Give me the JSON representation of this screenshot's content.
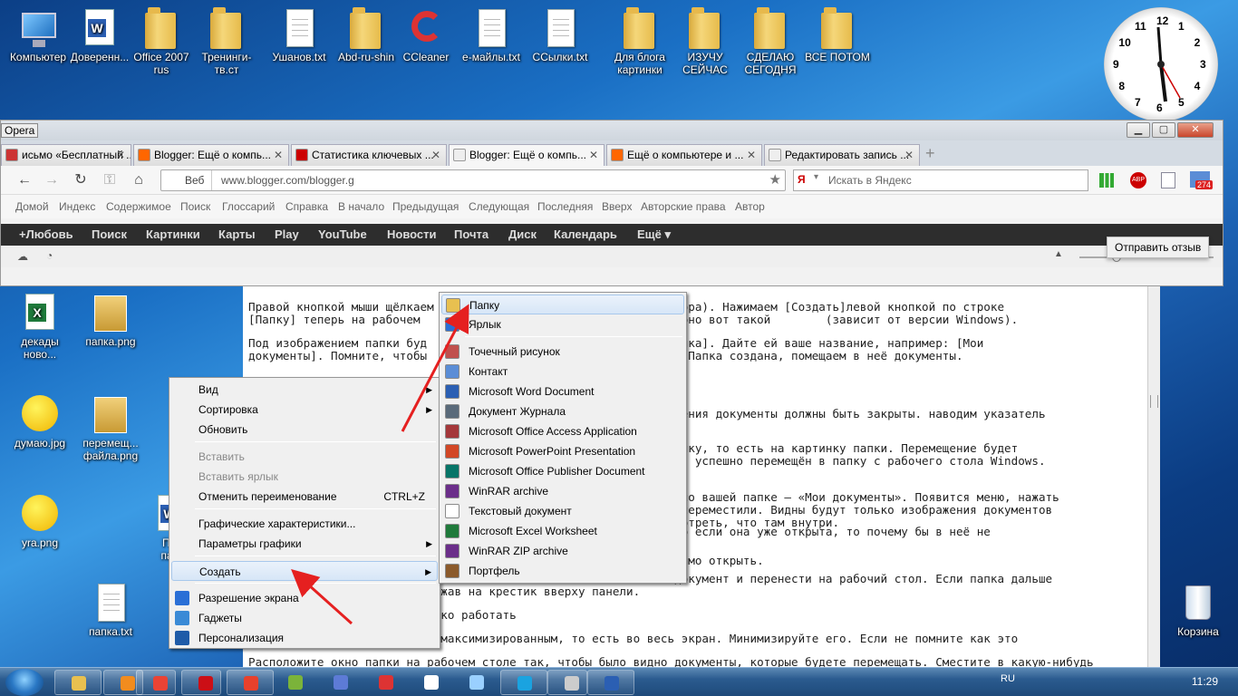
{
  "desktop": {
    "top_icons": [
      "Компьютер",
      "Доверенн...",
      "Office 2007\nrus",
      "Тренинги-\nтв.ст",
      "Ушанов.txt",
      "Abd-ru-shin",
      "CCleaner",
      "е-майлы.txt",
      "ССылки.txt",
      "Для блога\nкартинки",
      "ИЗУЧУ\nСЕЙЧАС",
      "СДЕЛАЮ\nСЕГОДНЯ",
      "ВСЕ ПОТОМ"
    ],
    "left_icons": [
      "декады\nново...",
      "папка.png",
      "думаю.jpg",
      "перемещ...\nфайла.png",
      "yra.png",
      "Пон\nпапк",
      "папка.txt"
    ],
    "recycle": "Корзина"
  },
  "clock_gadget": {
    "numbers": [
      "12",
      "1",
      "2",
      "3",
      "4",
      "5",
      "6",
      "7",
      "8",
      "9",
      "10",
      "11"
    ]
  },
  "browser": {
    "app": "Opera",
    "win_min": "▁",
    "win_max": "▢",
    "win_close": "✕",
    "tabs": [
      {
        "label": "исьмо «Бесплатный ...",
        "color": "#c33"
      },
      {
        "label": "Blogger: Ещё о компь...",
        "color": "#f60"
      },
      {
        "label": "Статистика ключевых ...",
        "color": "#c00"
      },
      {
        "label": "Blogger: Ещё о компь...",
        "color": "#eee"
      },
      {
        "label": "Ещё о компьютере и ...",
        "color": "#f60"
      },
      {
        "label": "Редактировать запись ...",
        "color": "#eee"
      }
    ],
    "tab_close": "✕",
    "veb": "Веб",
    "url": "www.blogger.com/blogger.g",
    "search_placeholder": "Искать в Яндекс",
    "badge": "274",
    "bookmarks": [
      "Домой",
      "Индекс",
      "Содержимое",
      "Поиск",
      "Глоссарий",
      "Справка",
      "В начало",
      "Предыдущая",
      "Следующая",
      "Последняя",
      "Вверх",
      "Авторские права",
      "Автор"
    ],
    "gbar": [
      "+Любовь",
      "Поиск",
      "Картинки",
      "Карты",
      "Play",
      "YouTube",
      "Новости",
      "Почта",
      "Диск",
      "Календарь",
      "Ещё ▾"
    ],
    "feedback": "Отправить отзыв"
  },
  "page_text": [
    "Правой кнопкой мыши щёлкаем                             е монитора). Нажимаем \u0001[Создать]\u0001левой кнопкой по строке",
    "[Папку] \u0001теперь на рабочем                             ок, примерно вот такой        (зависит от версии Windows).",
    "Под изображением папки буд                             новая папка]. Дайте ей ваше название, например: [Мои",
    "документы]. Помните, чтобы                             [Enter]. Папка создана, помещаем в неё документы.",
    "                                                        перемещения документы должны быть закрыты. наводим указатель",
    "                                                        т на папку, то есть на картинку папки. Перемещение будет",
    "                                                        документ успешно перемещён в папку с рабочего стола Windows.",
    "                                                        правой по вашей папке – «Мои документы». Появится меню, нажать",
    "                                                        е туда переместили. Видны будут только изображения документов",
    "                                                         и посмотреть, что там внутри.",
    "                                                        вать, но если она уже открыта, то почему бы в неё не",
    "                                                        необходимо открыть.",
    "                                                        й вам документ и перенести на рабочий стол. Если папка дальше",
    "                 акройте, нажав на крестик вверху панели.",
    "                   можно легко работать",
    "                  открыться максимизированным, то есть во весь экран. Минимизируйте его. Если не помните как это",
    "Расположите окно папки на рабочем столе так, чтобы было видно документы, которые будете перемещать. Сместите в какую-нибудь"
  ],
  "context_menu": {
    "items": [
      "Вид",
      "Сортировка",
      "Обновить",
      "Вставить",
      "Вставить ярлык",
      "Отменить переименование",
      "Графические характеристики...",
      "Параметры графики",
      "Создать",
      "Разрешение экрана",
      "Гаджеты",
      "Персонализация"
    ],
    "shortcut": "CTRL+Z"
  },
  "submenu": {
    "items": [
      "Папку",
      "Ярлык",
      "Точечный рисунок",
      "Контакт",
      "Microsoft Word Document",
      "Документ Журнала",
      "Microsoft Office Access Application",
      "Microsoft PowerPoint Presentation",
      "Microsoft Office Publisher Document",
      "WinRAR archive",
      "Текстовый документ",
      "Microsoft Excel Worksheet",
      "WinRAR ZIP archive",
      "Портфель"
    ],
    "icon_colors": [
      "#e8c050",
      "#2a6fd6",
      "#c0504d",
      "#5b8dd6",
      "#2b5fb3",
      "#5a6a7a",
      "#a4373a",
      "#d24726",
      "#077568",
      "#6b2e8a",
      "#ffffff",
      "#1f7a3b",
      "#6b2e8a",
      "#8b5a2b"
    ]
  },
  "taskbar": {
    "lang": "RU",
    "time": "11:29"
  }
}
